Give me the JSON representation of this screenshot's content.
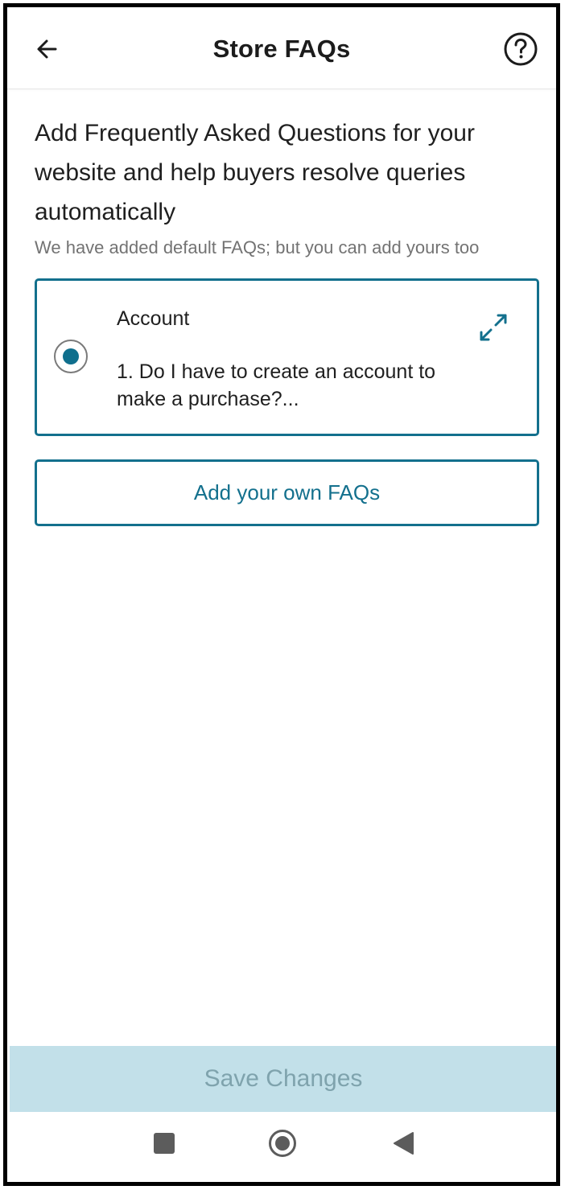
{
  "header": {
    "title": "Store FAQs",
    "back_icon": "arrow-left-icon",
    "help_icon": "help-circle-icon"
  },
  "intro": {
    "text": "Add Frequently Asked Questions for your website and help buyers resolve queries automatically",
    "subtext": "We have added default FAQs; but you can add yours too"
  },
  "faq_card": {
    "selected": true,
    "category": "Account",
    "question": "1. Do I have to create an account to make a purchase?...",
    "expand_icon": "expand-icon"
  },
  "add_faq_label": "Add your own FAQs",
  "save_label": "Save Changes",
  "nav": {
    "recents_icon": "square-icon",
    "home_icon": "home-circle-icon",
    "back_icon": "triangle-back-icon"
  },
  "colors": {
    "accent": "#13708d",
    "save_bg": "#c2e0e9",
    "save_text": "#7fa3ad"
  }
}
